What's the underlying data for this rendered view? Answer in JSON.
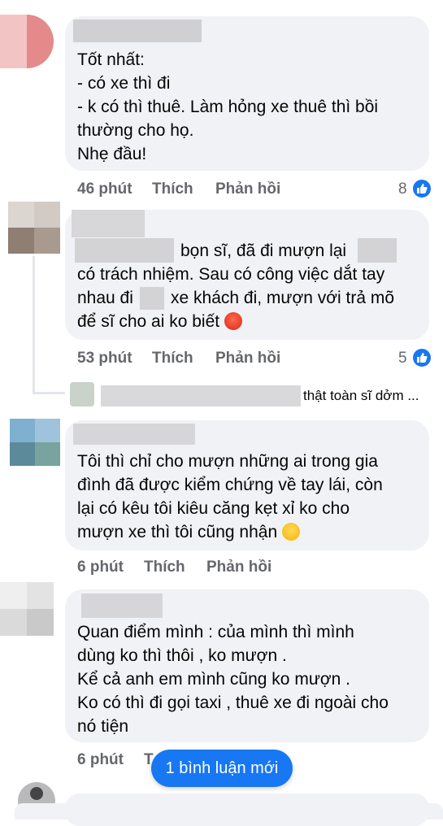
{
  "comments": [
    {
      "lines": [
        "Tốt nhất:",
        "- có xe thì đi",
        "- k có thì thuê. Làm hỏng xe thuê thì bồi",
        "thường cho họ.",
        "Nhẹ đầu!"
      ],
      "time": "46 phút",
      "like_label": "Thích",
      "reply_label": "Phản hồi",
      "reactions": "8"
    },
    {
      "lines": [
        "bọn sĩ, đã đi mượn lại",
        "có trách nhiệm. Sau có công việc dắt tay",
        "nhau đi",
        "xe khách đi, mượn với trả mõ",
        "để sĩ cho ai ko biết"
      ],
      "time": "53 phút",
      "like_label": "Thích",
      "reply_label": "Phản hồi",
      "reactions": "5"
    },
    {
      "lines": [
        "Tôi thì chỉ cho mượn những ai trong gia",
        "đình đã được kiểm chứng về tay lái, còn",
        "lại có kêu tôi kiêu căng kẹt xỉ ko cho",
        "mượn xe thì tôi cũng nhận"
      ],
      "time": "6 phút",
      "like_label": "Thích",
      "reply_label": "Phản hồi"
    },
    {
      "lines": [
        "Quan điểm mình :  của mình thì mình",
        "dùng ko thì thôi , ko mượn .",
        "Kể cả anh em mình cũng ko mượn .",
        "Ko có thì đi gọi taxi , thuê xe đi ngoài cho",
        "nó tiện"
      ],
      "time": "6 phút",
      "like_label": "T"
    }
  ],
  "reply_preview": "thật toàn sĩ dởm ...",
  "new_comments_button": "1 bình luận mới",
  "colors": {
    "accent": "#1877f2",
    "bubble": "#f0f2f5",
    "meta": "#65676b"
  }
}
